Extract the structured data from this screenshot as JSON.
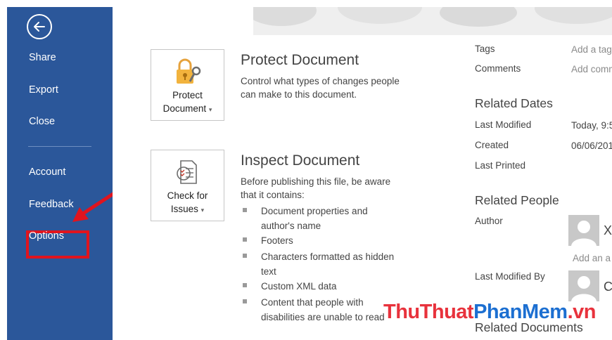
{
  "sidebar": {
    "items": [
      {
        "label": "Share"
      },
      {
        "label": "Export"
      },
      {
        "label": "Close"
      },
      {
        "label": "Account"
      },
      {
        "label": "Feedback"
      },
      {
        "label": "Options"
      }
    ]
  },
  "protect": {
    "button_line1": "Protect",
    "button_line2": "Document",
    "title": "Protect Document",
    "desc_line1": "Control what types of changes people",
    "desc_line2": "can make to this document."
  },
  "inspect": {
    "button_line1": "Check for",
    "button_line2": "Issues",
    "title": "Inspect Document",
    "desc_line1": "Before publishing this file, be aware",
    "desc_line2": "that it contains:",
    "bullets": [
      {
        "line1": "Document properties and",
        "line2": "author's name"
      },
      {
        "line1": "Footers",
        "line2": ""
      },
      {
        "line1": "Characters formatted as hidden",
        "line2": "text"
      },
      {
        "line1": "Custom XML data",
        "line2": ""
      },
      {
        "line1": "Content that people with",
        "line2": "disabilities are unable to read"
      }
    ]
  },
  "properties": {
    "tags_label": "Tags",
    "tags_value": "Add a tag",
    "comments_label": "Comments",
    "comments_value": "Add comm",
    "related_dates": "Related Dates",
    "last_modified_label": "Last Modified",
    "last_modified_value": "Today, 9:5",
    "created_label": "Created",
    "created_value": "06/06/201",
    "last_printed_label": "Last Printed",
    "related_people": "Related People",
    "author_label": "Author",
    "author_initial": "X",
    "add_author": "Add an a",
    "last_modified_by_label": "Last Modified By",
    "modifier_initial": "C",
    "related_documents": "Related Documents"
  },
  "watermark": {
    "part1": "ThuThuat",
    "part2": "PhanMem",
    "part3": ".vn"
  },
  "colors": {
    "sidebar_bg": "#2b579a",
    "highlight_red": "#e0141e",
    "watermark_red": "#e8323c",
    "watermark_blue": "#1c6fd1"
  }
}
